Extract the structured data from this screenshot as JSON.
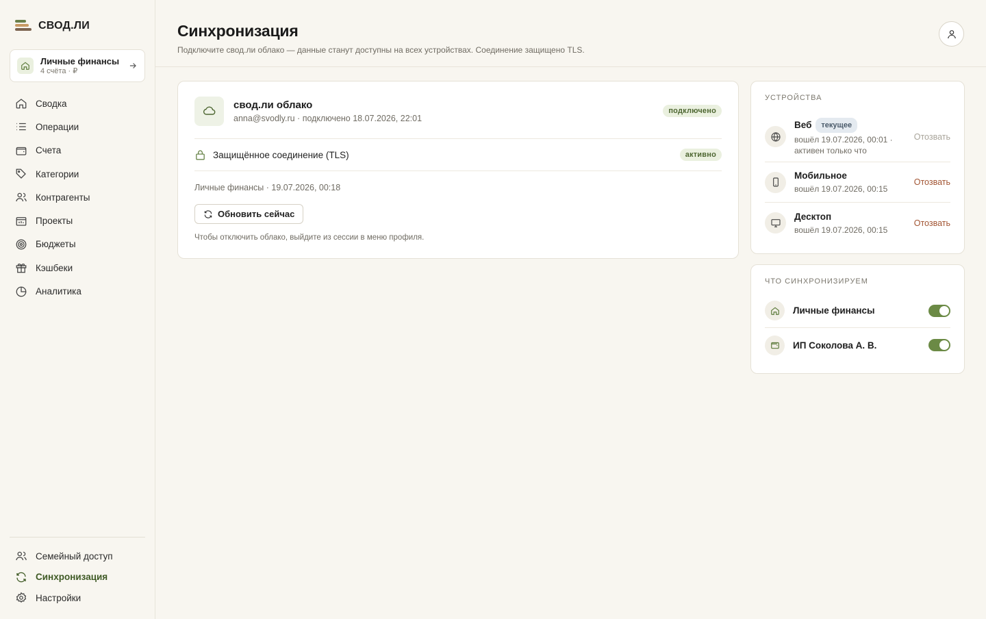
{
  "brand": {
    "name": "СВОД.ЛИ"
  },
  "workspace": {
    "name": "Личные финансы",
    "sub": "4 счёта · ₽"
  },
  "nav": {
    "items": [
      {
        "label": "Сводка",
        "icon": "home-icon"
      },
      {
        "label": "Операции",
        "icon": "list-icon"
      },
      {
        "label": "Счета",
        "icon": "wallet-icon"
      },
      {
        "label": "Категории",
        "icon": "tag-icon"
      },
      {
        "label": "Контрагенты",
        "icon": "users-icon"
      },
      {
        "label": "Проекты",
        "icon": "folder-icon"
      },
      {
        "label": "Бюджеты",
        "icon": "target-icon"
      },
      {
        "label": "Кэшбеки",
        "icon": "gift-icon"
      },
      {
        "label": "Аналитика",
        "icon": "pie-icon"
      }
    ],
    "bottom": [
      {
        "label": "Семейный доступ",
        "icon": "users-icon"
      },
      {
        "label": "Синхронизация",
        "icon": "sync-icon",
        "active": true
      },
      {
        "label": "Настройки",
        "icon": "gear-icon"
      }
    ]
  },
  "header": {
    "title": "Синхронизация",
    "subtitle": "Подключите свод.ли облако — данные станут доступны на всех устройствах. Соединение защищено TLS."
  },
  "cloud": {
    "title": "свод.ли облако",
    "meta": "anna@svodly.ru · подключено 18.07.2026, 22:01",
    "status": "подключено",
    "tls_label": "Защищённое соединение (TLS)",
    "tls_status": "активно",
    "last_sync": "Личные финансы · 19.07.2026, 00:18",
    "refresh_label": "Обновить сейчас",
    "hint": "Чтобы отключить облако, выйдите из сессии в меню профиля."
  },
  "devices": {
    "label": "Устройства",
    "items": [
      {
        "name": "Веб",
        "tag": "текущее",
        "meta1": "вошёл 19.07.2026, 00:01 ·",
        "meta2": "активен только что",
        "action": "Отозвать",
        "disabled": true
      },
      {
        "name": "Мобильное",
        "meta1": "вошёл 19.07.2026, 00:15",
        "action": "Отозвать"
      },
      {
        "name": "Десктоп",
        "meta1": "вошёл 19.07.2026, 00:15",
        "action": "Отозвать"
      }
    ]
  },
  "sync_what": {
    "label": "Что синхронизируем",
    "items": [
      {
        "name": "Личные финансы",
        "enabled": true
      },
      {
        "name": "ИП Соколова А. В.",
        "enabled": true
      }
    ]
  },
  "colors": {
    "accent": "#6b8a45",
    "revoke": "#a25533",
    "background": "#f8f6f0"
  }
}
